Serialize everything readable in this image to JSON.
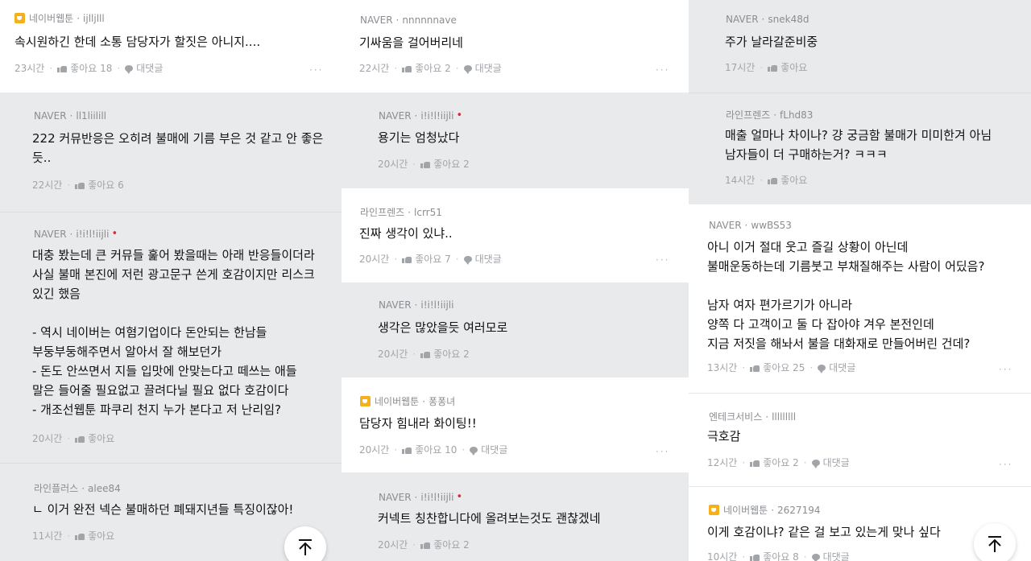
{
  "columns": [
    {
      "comments": [
        {
          "badge": true,
          "source": "네이버웹툰",
          "user": "ijlljlll",
          "dot": false,
          "body": "속시원하긴 한데 소통 담당자가 할짓은 아니지....",
          "time": "23시간",
          "likes": "좋아요 18",
          "reply": "대댓글",
          "more": true
        },
        {
          "badge": false,
          "source": "NAVER",
          "user": "ll1liilill",
          "dot": false,
          "body": "222 커뮤반응은 오히려 불매에 기름 부은 것 같고 안 좋은\n듯..",
          "time": "22시간",
          "likes": "좋아요 6",
          "reply": "",
          "more": false
        },
        {
          "badge": false,
          "source": "NAVER",
          "user": "i!i!l!iijli",
          "dot": true,
          "body": "대충 봤는데 큰 커뮤들 훑어 봤을때는 아래 반응들이더라\n사실 불매 본진에 저런 광고문구 쓴게 호감이지만 리스크\n있긴 했음\n\n- 역시 네이버는 여혐기업이다 돈안되는 한남들\n부둥부둥해주면서 알아서 잘 해보던가\n- 돈도 안쓰면서 지들 입맛에 안맞는다고 떼쓰는 애들\n말은 들어줄 필요없고 끌려다닐 필요 없다 호감이다\n- 개조선웹툰 파쿠리 천지 누가 본다고 저 난리임?",
          "time": "20시간",
          "likes": "좋아요",
          "reply": "",
          "more": false
        },
        {
          "badge": false,
          "source": "라인플러스",
          "user": "alee84",
          "dot": false,
          "body": "ㄴ 이거 완전 넥슨 불매하던 폐돼지년들 특징이잖아!",
          "time": "11시간",
          "likes": "좋아요",
          "reply": "",
          "more": false
        }
      ]
    },
    {
      "comments": [
        {
          "badge": false,
          "source": "NAVER",
          "user": "nnnnnnave",
          "dot": false,
          "body": "기싸움을 걸어버리네",
          "time": "22시간",
          "likes": "좋아요 2",
          "reply": "대댓글",
          "more": true
        },
        {
          "badge": false,
          "source": "NAVER",
          "user": "i!i!l!iijli",
          "dot": true,
          "body": "용기는 엄청났다",
          "time": "20시간",
          "likes": "좋아요 2",
          "reply": "",
          "more": false
        },
        {
          "badge": false,
          "source": "라인프렌즈",
          "user": "lcrr51",
          "dot": false,
          "body": "진짜 생각이 있냐..",
          "time": "20시간",
          "likes": "좋아요 7",
          "reply": "대댓글",
          "more": true
        },
        {
          "badge": false,
          "source": "NAVER",
          "user": "i!i!l!iijli",
          "dot": false,
          "body": "생각은 많았을듯 여러모로",
          "time": "20시간",
          "likes": "좋아요 2",
          "reply": "",
          "more": false
        },
        {
          "badge": true,
          "source": "네이버웹툰",
          "user": "퐁퐁녀",
          "dot": false,
          "body": "담당자 힘내라 화이팅!!",
          "time": "20시간",
          "likes": "좋아요 10",
          "reply": "대댓글",
          "more": true
        },
        {
          "badge": false,
          "source": "NAVER",
          "user": "i!i!l!iijli",
          "dot": true,
          "body": "커넥트 칭찬합니다에 올려보는것도 괜찮겠네",
          "time": "20시간",
          "likes": "좋아요 2",
          "reply": "",
          "more": false
        }
      ]
    },
    {
      "comments": [
        {
          "badge": false,
          "source": "NAVER",
          "user": "snek48d",
          "dot": false,
          "body": "주가 날라갈준비중",
          "time": "17시간",
          "likes": "좋아요",
          "reply": "",
          "more": false
        },
        {
          "badge": false,
          "source": "라인프렌즈",
          "user": "fLhd83",
          "dot": false,
          "body": "매출 얼마나 차이나? 걍 궁금함 불매가 미미한겨 아님\n남자들이 더 구매하는거? ㅋㅋㅋ",
          "time": "14시간",
          "likes": "좋아요",
          "reply": "",
          "more": false
        },
        {
          "badge": false,
          "source": "NAVER",
          "user": "wwBS53",
          "dot": false,
          "body": "아니 이거 절대 웃고 즐길 상황이 아닌데\n불매운동하는데 기름붓고 부채질해주는 사람이 어딨음?\n\n남자 여자 편가르기가 아니라\n양쪽 다 고객이고 둘 다 잡아야 겨우 본전인데\n지금 저짓을 해놔서 불을 대화재로 만들어버린 건데?",
          "time": "13시간",
          "likes": "좋아요 25",
          "reply": "대댓글",
          "more": true
        },
        {
          "badge": false,
          "source": "엔테크서비스",
          "user": "lllllllll",
          "dot": false,
          "body": "극호감",
          "time": "12시간",
          "likes": "좋아요 2",
          "reply": "대댓글",
          "more": true
        },
        {
          "badge": true,
          "source": "네이버웹툰",
          "user": "2627194",
          "dot": false,
          "body": "이게 호감이냐? 같은 걸 보고 있는게 맞나 싶다",
          "time": "10시간",
          "likes": "좋아요 8",
          "reply": "대댓글",
          "more": false
        }
      ]
    }
  ],
  "ui": {
    "more_glyph": "···",
    "sep": "·",
    "top_icon": "arrow-up-to-top-icon"
  }
}
